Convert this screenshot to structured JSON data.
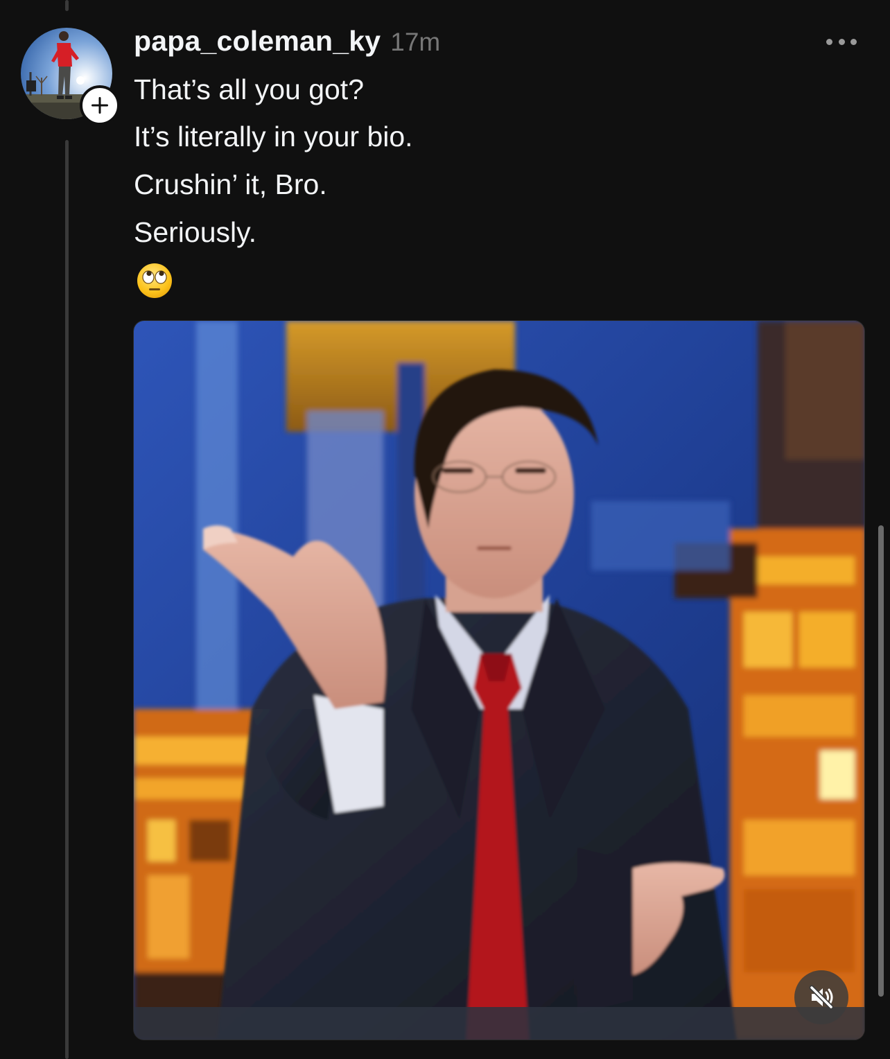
{
  "post": {
    "username": "papa_coleman_ky",
    "timestamp": "17m",
    "lines": [
      "That’s all you got?",
      "It’s literally in your bio.",
      "Crushin’ it, Bro.",
      "Seriously."
    ],
    "emoji": "face-with-rolling-eyes"
  },
  "icons": {
    "follow": "plus-icon",
    "more": "more-horizontal-icon",
    "mute": "speaker-muted-icon"
  },
  "media": {
    "type": "video",
    "muted": true
  },
  "colors": {
    "background": "#101010",
    "text": "#f3f5f7",
    "muted_text": "#777777"
  }
}
